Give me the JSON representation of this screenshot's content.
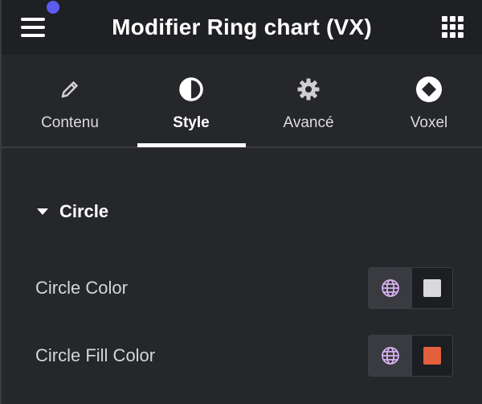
{
  "header": {
    "title": "Modifier Ring chart (VX)",
    "menu_icon": "hamburger-menu-icon",
    "apps_icon": "grid-apps-icon",
    "notification_color": "#5b5bf0"
  },
  "tabs": [
    {
      "label": "Contenu",
      "icon": "pencil-icon",
      "active": false
    },
    {
      "label": "Style",
      "icon": "half-circle-contrast-icon",
      "active": true
    },
    {
      "label": "Avancé",
      "icon": "gear-icon",
      "active": false
    },
    {
      "label": "Voxel",
      "icon": "diamond-circle-icon",
      "active": false
    }
  ],
  "section": {
    "title": "Circle",
    "expanded": true,
    "controls": [
      {
        "label": "Circle Color",
        "swatch_color": "#d9d9dc",
        "globe_icon": "globe-icon"
      },
      {
        "label": "Circle Fill Color",
        "swatch_color": "#e2603d",
        "globe_icon": "globe-icon"
      }
    ]
  },
  "colors": {
    "accent_globe": "#d7b1f0",
    "background": "#26272b",
    "header_background": "#1f2024"
  }
}
